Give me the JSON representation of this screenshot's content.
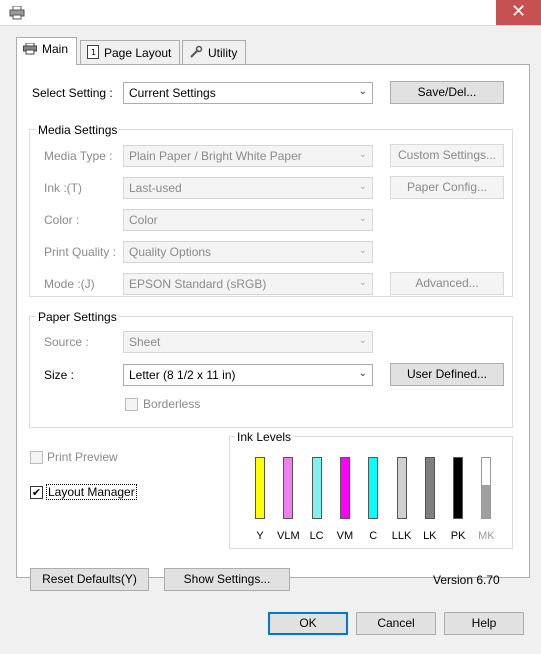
{
  "window": {
    "close_glyph": "✕",
    "icon": "printer-icon"
  },
  "tabs": [
    {
      "label": "Main",
      "icon": "printer-icon"
    },
    {
      "label": "Page Layout",
      "icon": "page-icon"
    },
    {
      "label": "Utility",
      "icon": "wrench-icon"
    }
  ],
  "select_setting": {
    "label": "Select Setting :",
    "value": "Current Settings",
    "save_button": "Save/Del..."
  },
  "media_settings": {
    "title": "Media Settings",
    "media_type": {
      "label": "Media Type :",
      "value": "Plain Paper / Bright White Paper"
    },
    "ink": {
      "label": "Ink :(T)",
      "value": "Last-used"
    },
    "color": {
      "label": "Color :",
      "value": "Color"
    },
    "print_quality": {
      "label": "Print Quality :",
      "value": "Quality Options"
    },
    "mode": {
      "label": "Mode :(J)",
      "value": "EPSON Standard (sRGB)"
    },
    "custom_settings_button": "Custom Settings...",
    "paper_config_button": "Paper Config...",
    "advanced_button": "Advanced..."
  },
  "paper_settings": {
    "title": "Paper Settings",
    "source": {
      "label": "Source :",
      "value": "Sheet"
    },
    "size": {
      "label": "Size :",
      "value": "Letter (8 1/2 x 11 in)"
    },
    "user_defined_button": "User Defined...",
    "borderless_label": "Borderless"
  },
  "options": {
    "print_preview": {
      "label": "Print Preview",
      "checked": false
    },
    "layout_manager": {
      "label": "Layout Manager",
      "checked": true
    }
  },
  "ink_levels": {
    "title": "Ink Levels",
    "inks": [
      {
        "name": "Y",
        "color": "#ffff00",
        "level": 1.0
      },
      {
        "name": "VLM",
        "color": "#f080f0",
        "level": 1.0
      },
      {
        "name": "LC",
        "color": "#80f0f0",
        "level": 1.0
      },
      {
        "name": "VM",
        "color": "#ff00ff",
        "level": 1.0
      },
      {
        "name": "C",
        "color": "#00ffff",
        "level": 1.0
      },
      {
        "name": "LLK",
        "color": "#d0d0d0",
        "level": 1.0
      },
      {
        "name": "LK",
        "color": "#808080",
        "level": 1.0
      },
      {
        "name": "PK",
        "color": "#000000",
        "level": 1.0
      },
      {
        "name": "MK",
        "color": "#a0a0a0",
        "level": 0.55
      }
    ]
  },
  "bottom": {
    "reset_button": "Reset Defaults(Y)",
    "show_settings_button": "Show Settings...",
    "version": "Version 6.70"
  },
  "footer": {
    "ok": "OK",
    "cancel": "Cancel",
    "help": "Help"
  }
}
